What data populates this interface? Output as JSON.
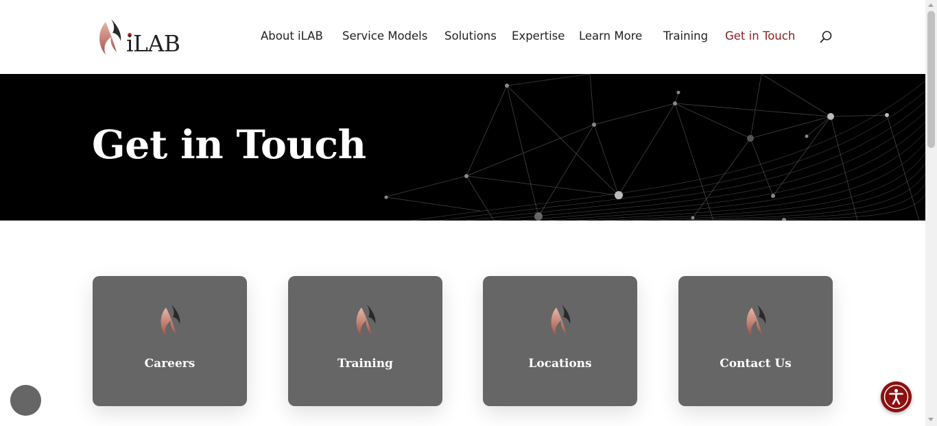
{
  "logo": {
    "text": "iLAB",
    "icon": "flame-logo-icon"
  },
  "nav": {
    "items": [
      {
        "label": "About iLAB"
      },
      {
        "label": "Service Models"
      },
      {
        "label": "Solutions"
      },
      {
        "label": "Expertise"
      },
      {
        "label": "Learn More"
      },
      {
        "label": "Training"
      },
      {
        "label": "Get in Touch",
        "active": true
      }
    ],
    "search_icon": "search-icon"
  },
  "hero": {
    "title": "Get in Touch"
  },
  "cards": [
    {
      "label": "Careers",
      "icon": "flame-icon"
    },
    {
      "label": "Training",
      "icon": "flame-icon"
    },
    {
      "label": "Locations",
      "icon": "flame-icon"
    },
    {
      "label": "Contact Us",
      "icon": "flame-icon"
    }
  ],
  "floating": {
    "chat_icon": "chat-bubble",
    "accessibility_icon": "accessibility-icon"
  },
  "colors": {
    "accent": "#8b1e1e",
    "card_bg": "#666666",
    "hero_bg": "#000000",
    "a11y_bg": "#8b1010"
  }
}
